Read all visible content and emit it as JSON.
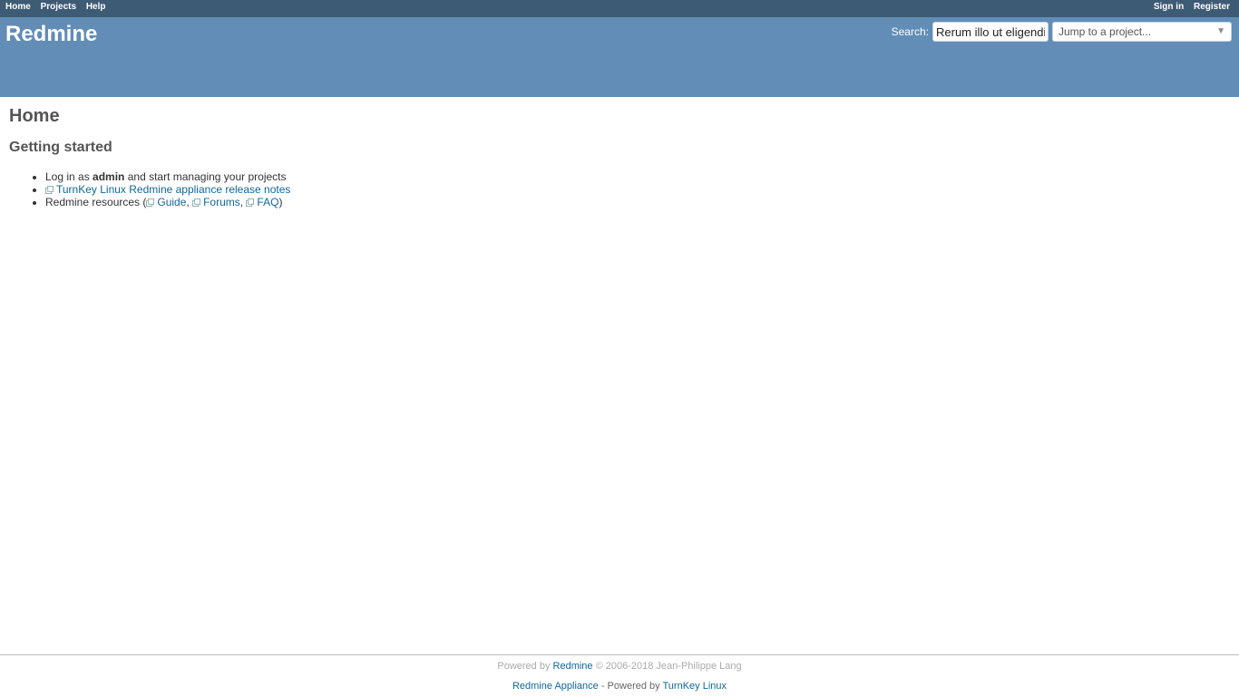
{
  "top_menu": {
    "left": [
      "Home",
      "Projects",
      "Help"
    ],
    "right": [
      "Sign in",
      "Register"
    ]
  },
  "header": {
    "title": "Redmine",
    "search_label": "Search",
    "search_value": "Rerum illo ut eligendi",
    "project_jump": "Jump to a project..."
  },
  "main": {
    "title": "Home",
    "subtitle": "Getting started",
    "login_prefix": "Log in as",
    "login_user": "admin",
    "login_suffix": "and start managing your projects",
    "release_notes_link": "TurnKey Linux Redmine appliance release notes",
    "resources_prefix": "Redmine resources (",
    "resources": [
      "Guide",
      "Forums",
      "FAQ"
    ],
    "resources_suffix": ")"
  },
  "footer": {
    "powered_by": "Powered by",
    "redmine_link": "Redmine",
    "copyright": "© 2006-2018 Jean-Philippe Lang",
    "appliance_link": "Redmine Appliance",
    "powered_by_2": "- Powered by",
    "turnkey_link": "TurnKey Linux"
  },
  "colors": {
    "top_menu_bg": "#3e5b76",
    "header_bg": "#628db6",
    "link": "#116699"
  }
}
